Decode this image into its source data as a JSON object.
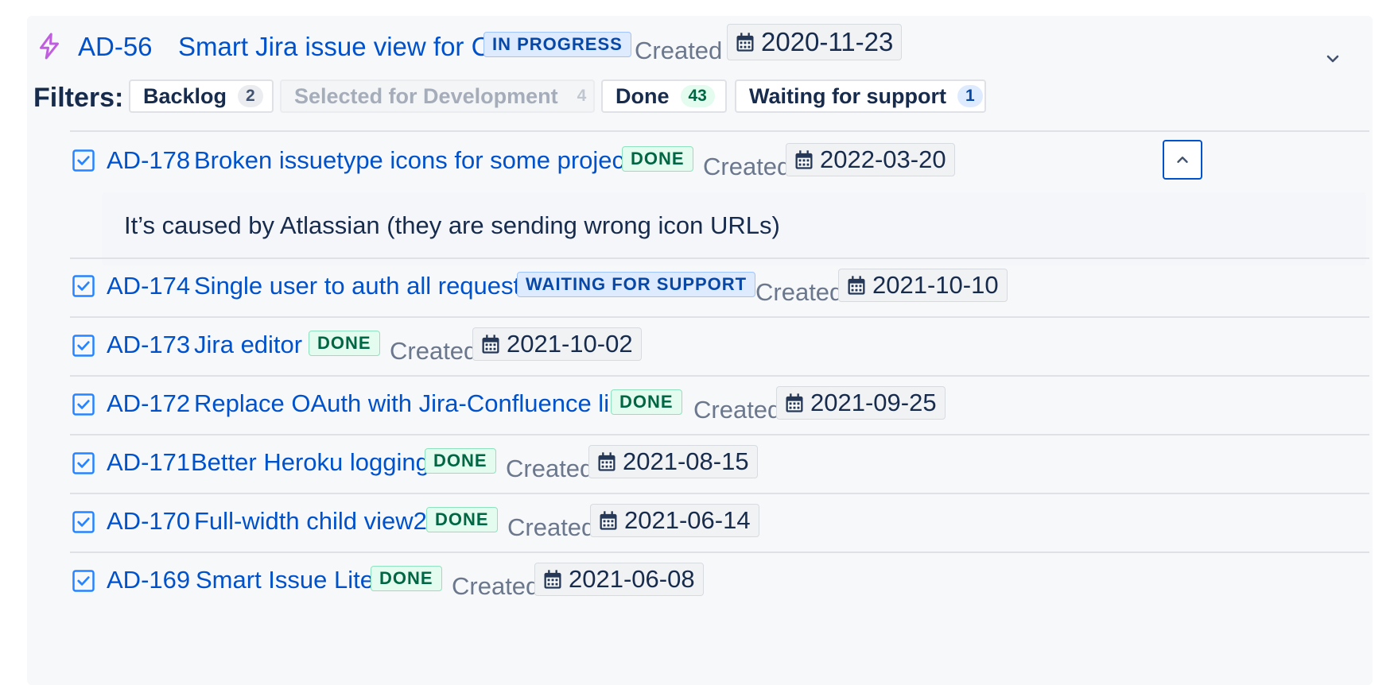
{
  "epic": {
    "key": "AD-56",
    "title": "Smart Jira issue view for CF",
    "status": "IN PROGRESS",
    "created_label": "Created",
    "created_date": "2020-11-23"
  },
  "filters": {
    "label": "Filters:",
    "items": [
      {
        "label": "Backlog",
        "count": "2"
      },
      {
        "label": "Selected for Development",
        "count": "4"
      },
      {
        "label": "Done",
        "count": "43"
      },
      {
        "label": "Waiting for support",
        "count": "1"
      }
    ]
  },
  "issues": [
    {
      "key": "AD-178",
      "title": "Broken issuetype icons for some projects",
      "status": "DONE",
      "created_label": "Created",
      "created_date": "2022-03-20",
      "description": "It’s caused by Atlassian (they are sending wrong icon URLs)"
    },
    {
      "key": "AD-174",
      "title": "Single user to auth all requests",
      "status": "WAITING FOR SUPPORT",
      "created_label": "Created",
      "created_date": "2021-10-10"
    },
    {
      "key": "AD-173",
      "title": "Jira editor",
      "status": "DONE",
      "created_label": "Created",
      "created_date": "2021-10-02"
    },
    {
      "key": "AD-172",
      "title": "Replace OAuth with Jira-Confluence link",
      "status": "DONE",
      "created_label": "Created",
      "created_date": "2021-09-25"
    },
    {
      "key": "AD-171",
      "title": "Better Heroku logging",
      "status": "DONE",
      "created_label": "Created",
      "created_date": "2021-08-15"
    },
    {
      "key": "AD-170",
      "title": "Full-width child view2",
      "status": "DONE",
      "created_label": "Created",
      "created_date": "2021-06-14"
    },
    {
      "key": "AD-169",
      "title": "Smart Issue Lite",
      "status": "DONE",
      "created_label": "Created",
      "created_date": "2021-06-08"
    }
  ],
  "icons": {
    "epic": "lightning-icon",
    "issue": "checkbox-icon",
    "date": "calendar-icon",
    "expand": "chevron-down-icon",
    "collapse": "chevron-up-icon"
  },
  "colors": {
    "link": "#0052cc",
    "epic_icon": "#c05ee0",
    "done_bg": "#e3fcef",
    "done_text": "#006644",
    "progress_bg": "#deebff",
    "progress_text": "#0747a6"
  }
}
